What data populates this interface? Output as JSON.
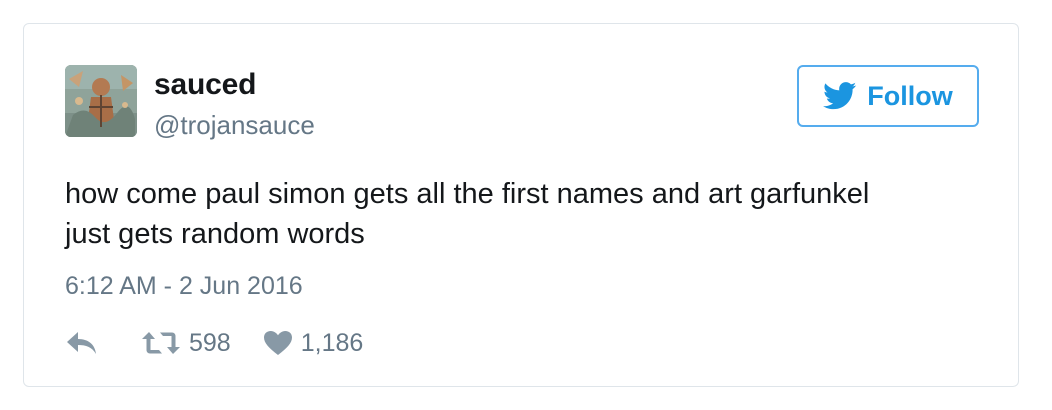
{
  "tweet": {
    "author": {
      "name": "sauced",
      "handle": "@trojansauce"
    },
    "follow_button": {
      "label": "Follow",
      "icon": "twitter-bird-icon"
    },
    "text_line1": "how come paul simon gets all the first names and art garfunkel",
    "text_line2": "just gets random words",
    "timestamp": "6:12 AM - 2 Jun 2016",
    "actions": {
      "reply_icon": "reply-icon",
      "retweet_icon": "retweet-icon",
      "retweet_count": "598",
      "like_icon": "heart-icon",
      "like_count": "1,186"
    }
  },
  "colors": {
    "accent": "#1b95e0",
    "secondary_text": "#657786",
    "primary_text": "#14171a",
    "border": "#dfe5ea"
  }
}
